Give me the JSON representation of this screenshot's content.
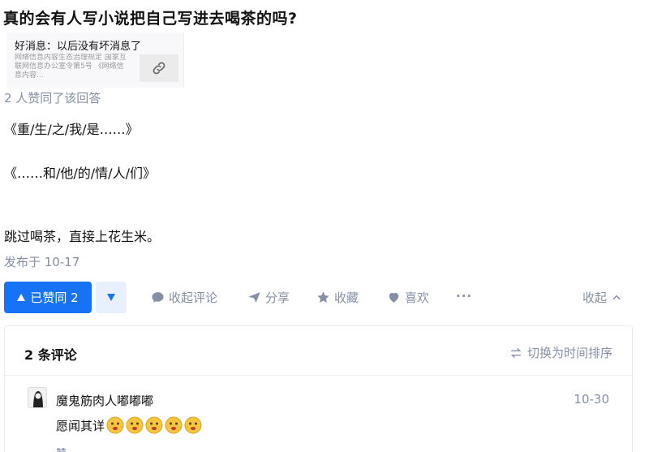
{
  "question": {
    "title": "真的会有人写小说把自己写进去喝茶的吗?"
  },
  "link_card": {
    "title": "好消息：以后没有坏消息了",
    "description": "网络信息内容生态治理规定 国家互联网信息办公室令第5号 《网络信息内容..."
  },
  "answer": {
    "voters_text": "2 人赞同了该回答",
    "paragraphs": [
      "《重/生/之/我/是……》",
      "《……和/他/的/情/人/们》",
      "跳过喝茶，直接上花生米。"
    ],
    "published": "发布于 10-17"
  },
  "actions": {
    "vote_up_label": "已赞同 2",
    "comment_label": "收起评论",
    "share_label": "分享",
    "favorite_label": "收藏",
    "like_label": "喜欢",
    "more_label": "···",
    "collapse_label": "收起"
  },
  "comments": {
    "header": "2 条评论",
    "sort_label": "切换为时间排序",
    "items": [
      {
        "author": "魔鬼筋肉人嘟嘟嘟",
        "date": "10-30",
        "text": "愿闻其详",
        "emoji_count": 5,
        "likes": "赞"
      }
    ]
  },
  "colors": {
    "accent": "#1772f6",
    "secondary_text": "#8590a6"
  }
}
